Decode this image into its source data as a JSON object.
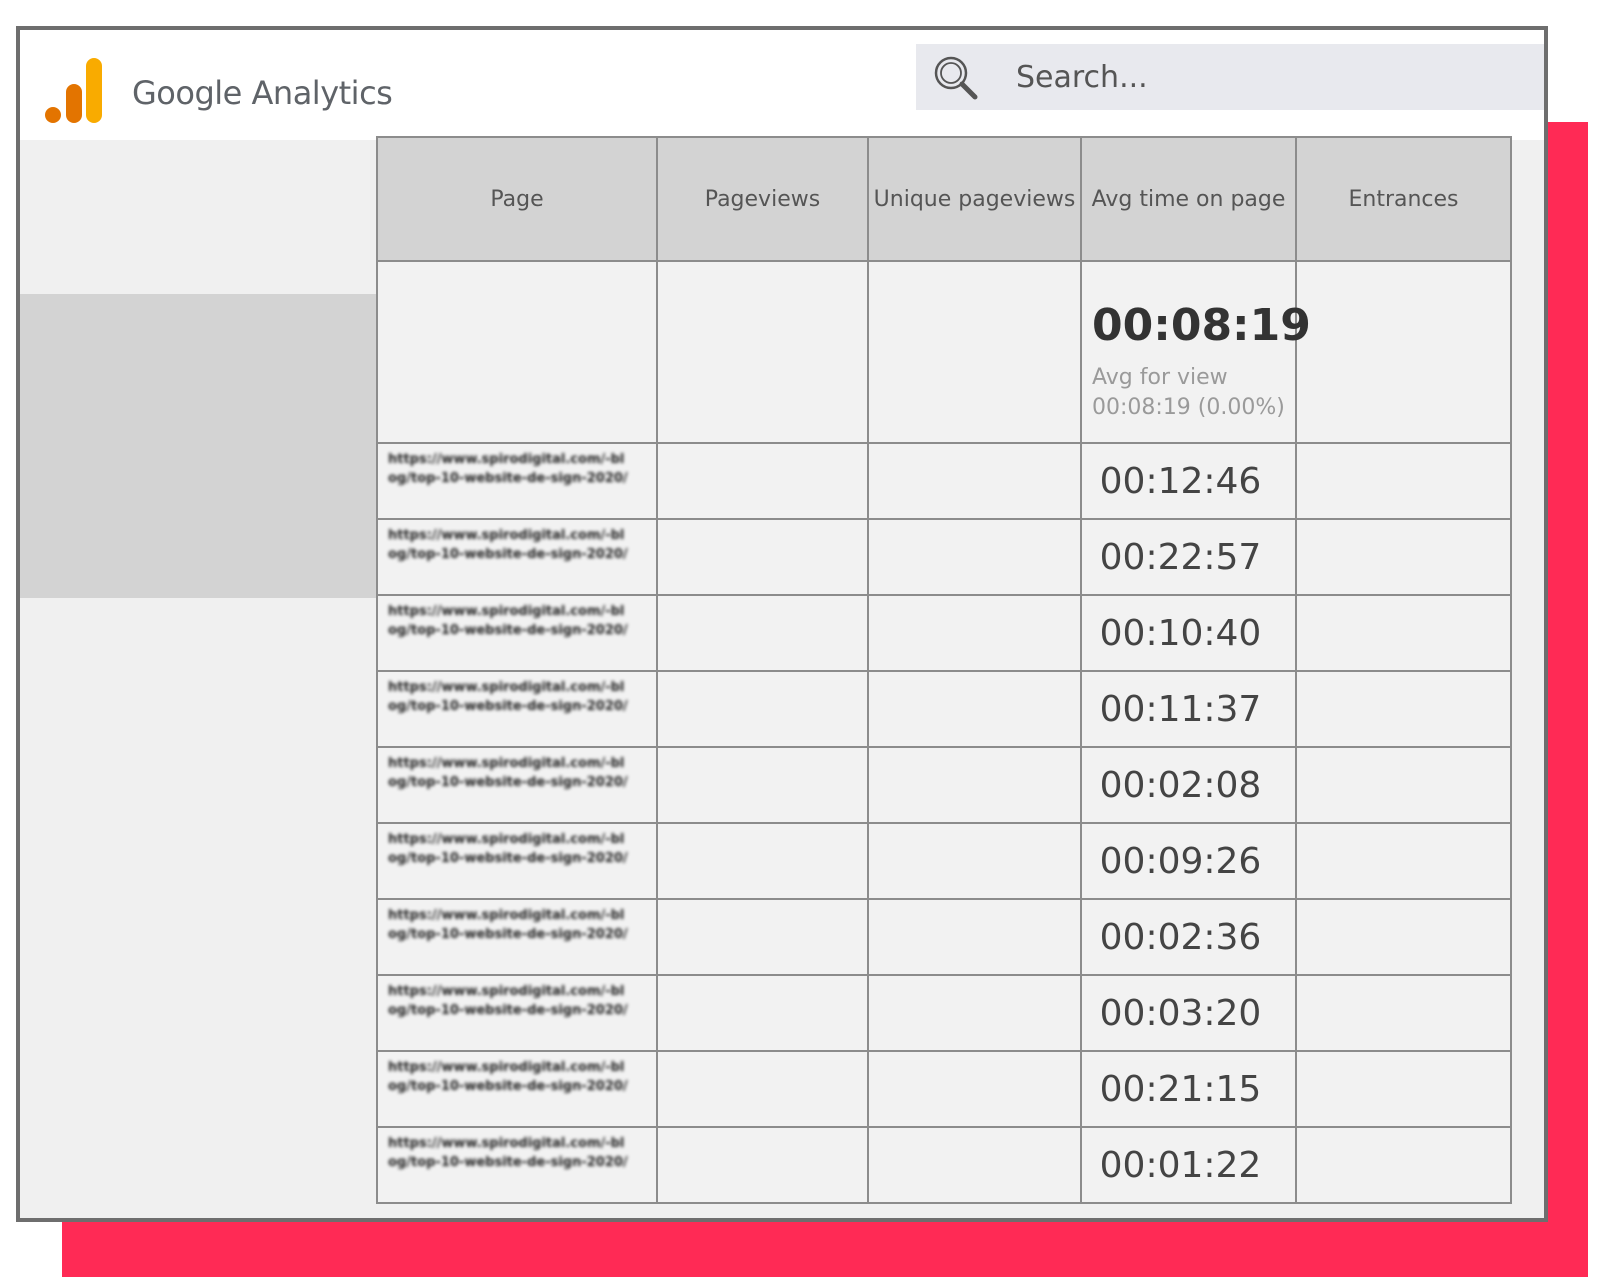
{
  "header": {
    "brand": "Google Analytics",
    "search": {
      "placeholder": "Search..."
    }
  },
  "colors": {
    "accent": "#ff2a55",
    "logo_orange_light": "#f9ab00",
    "logo_orange_dark": "#e37400",
    "header_bg": "#e8e9ee"
  },
  "icons": {
    "logo": "google-analytics-bars-icon",
    "search": "magnifier-icon"
  },
  "table": {
    "columns": [
      "Page",
      "Pageviews",
      "Unique pageviews",
      "Avg time on page",
      "Entrances"
    ],
    "summary": {
      "avg_time": "00:08:19",
      "avg_label": "Avg for view",
      "avg_sub": "00:08:19 (0.00%)"
    },
    "rows": [
      {
        "page": "https://www.spirodigital.com/-blog/top-10-website-de-sign-2020/",
        "avg_time": "00:12:46"
      },
      {
        "page": "https://www.spirodigital.com/-blog/top-10-website-de-sign-2020/",
        "avg_time": "00:22:57"
      },
      {
        "page": "https://www.spirodigital.com/-blog/top-10-website-de-sign-2020/",
        "avg_time": "00:10:40"
      },
      {
        "page": "https://www.spirodigital.com/-blog/top-10-website-de-sign-2020/",
        "avg_time": "00:11:37"
      },
      {
        "page": "https://www.spirodigital.com/-blog/top-10-website-de-sign-2020/",
        "avg_time": "00:02:08"
      },
      {
        "page": "https://www.spirodigital.com/-blog/top-10-website-de-sign-2020/",
        "avg_time": "00:09:26"
      },
      {
        "page": "https://www.spirodigital.com/-blog/top-10-website-de-sign-2020/",
        "avg_time": "00:02:36"
      },
      {
        "page": "https://www.spirodigital.com/-blog/top-10-website-de-sign-2020/",
        "avg_time": "00:03:20"
      },
      {
        "page": "https://www.spirodigital.com/-blog/top-10-website-de-sign-2020/",
        "avg_time": "00:21:15"
      },
      {
        "page": "https://www.spirodigital.com/-blog/top-10-website-de-sign-2020/",
        "avg_time": "00:01:22"
      }
    ]
  }
}
